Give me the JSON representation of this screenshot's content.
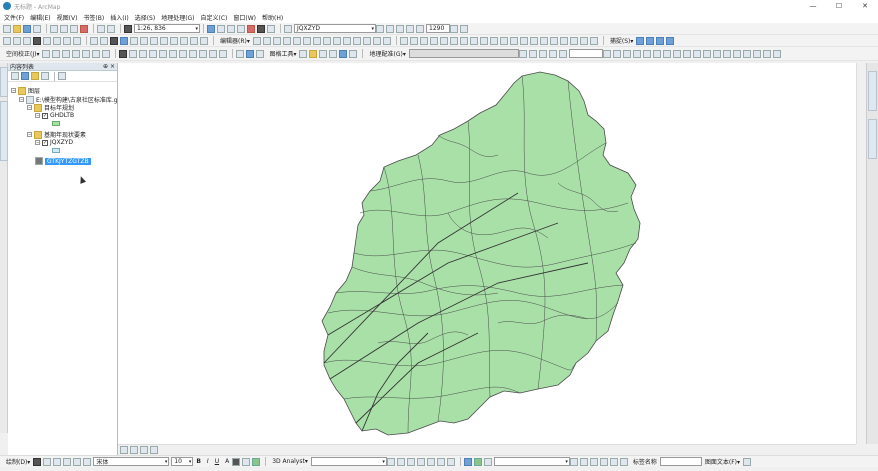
{
  "window": {
    "title": "无标题 - ArcMap"
  },
  "menu": [
    "文件(F)",
    "编辑(E)",
    "视图(V)",
    "书签(B)",
    "插入(I)",
    "选择(S)",
    "地理处理(G)",
    "自定义(C)",
    "窗口(W)",
    "帮助(H)"
  ],
  "toolbar1": {
    "scale": "1:26, 836",
    "layer_combo": "JQXZYD",
    "zoom_value": "1290"
  },
  "toolbar2": {
    "editor_label": "编辑器(R)▾",
    "snap_label": "捕捉(S)▾"
  },
  "toolbar3": {
    "georef_label": "空间校正(J)▾",
    "layout_label": "图格工具▾",
    "geo_label": "地理配准(G)▾"
  },
  "toc": {
    "title": "内容列表",
    "pin": "⊕ ×",
    "tree": {
      "root": "图层",
      "db_node": "E:\\模型构建\\古泉社区标准库.gdb",
      "group1": "目标年规划",
      "layer1": "GHDLTB",
      "group2": "基期年现状要素",
      "layer2": "JQXZYD",
      "layer3": "GTKJYTZGTZB"
    }
  },
  "left_tabs": [
    "目录",
    "ArcToolbox"
  ],
  "drawing": {
    "draw_label": "绘制(D)▾",
    "font_name": "宋体",
    "font_size": "10",
    "bold": "B",
    "italic": "I",
    "underline": "U",
    "text_a": "A",
    "analyst": "3D Analyst▾",
    "rotate_label": "图面文本(F)▾",
    "label_manager": "标签名称"
  },
  "colors": {
    "polygon_fill": "#a8e0a8",
    "polygon_stroke": "#4a4a4a",
    "selection": "#3399ff"
  },
  "map": {
    "road_color": "#333333"
  }
}
